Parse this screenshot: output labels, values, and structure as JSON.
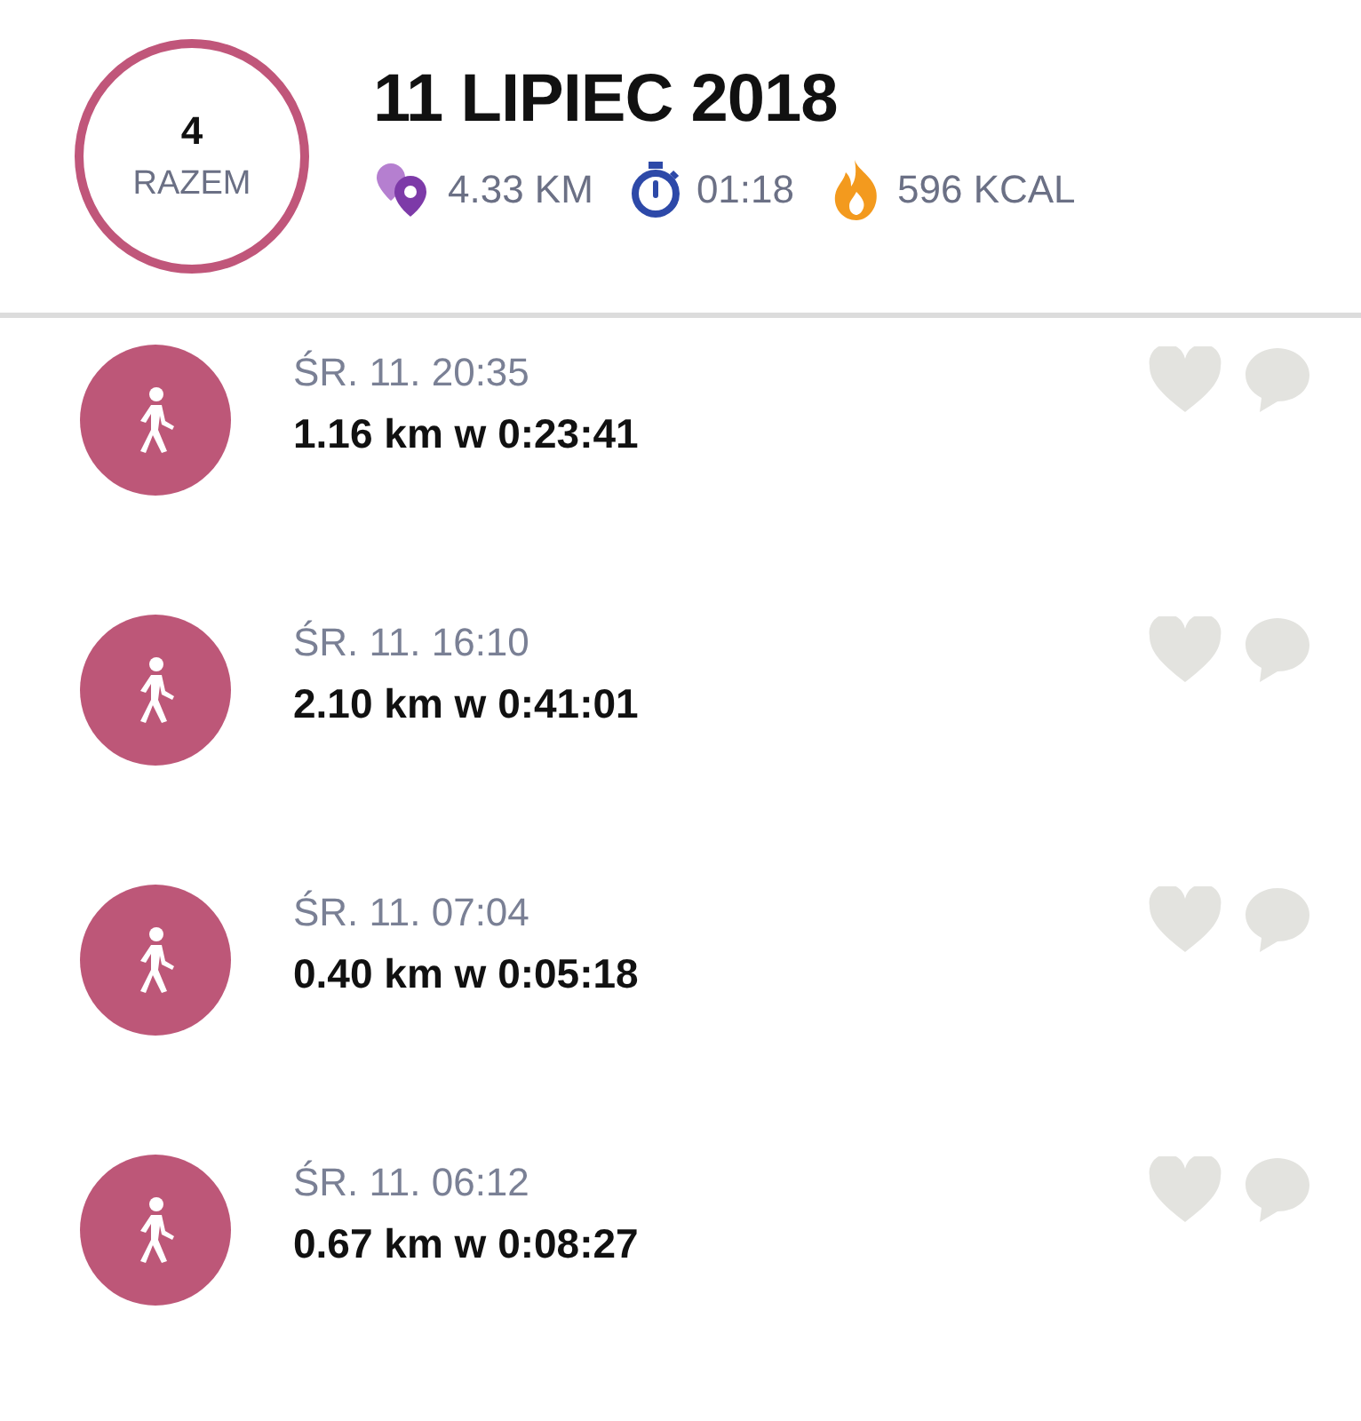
{
  "summary": {
    "count": "4",
    "count_label": "RAZEM",
    "date": "11 LIPIEC 2018",
    "distance": "4.33 KM",
    "duration": "01:18",
    "calories": "596 KCAL"
  },
  "activities": [
    {
      "time": "ŚR. 11. 20:35",
      "result": "1.16 km w 0:23:41"
    },
    {
      "time": "ŚR. 11. 16:10",
      "result": "2.10 km w 0:41:01"
    },
    {
      "time": "ŚR. 11. 07:04",
      "result": "0.40 km w 0:05:18"
    },
    {
      "time": "ŚR. 11. 06:12",
      "result": "0.67 km w 0:08:27"
    }
  ]
}
